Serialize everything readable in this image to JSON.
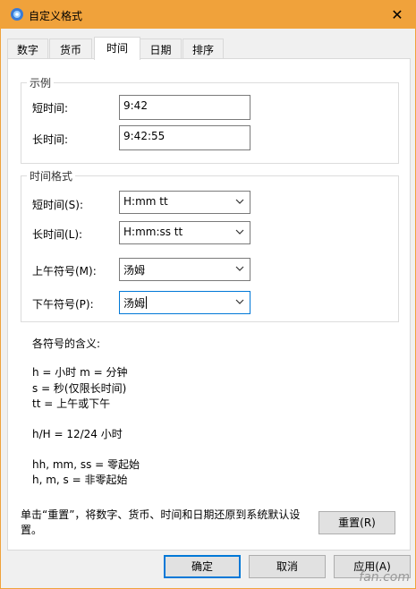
{
  "window": {
    "title": "自定义格式",
    "close_glyph": "✕"
  },
  "tabs": [
    {
      "label": "数字"
    },
    {
      "label": "货币"
    },
    {
      "label": "时间",
      "active": true
    },
    {
      "label": "日期"
    },
    {
      "label": "排序"
    }
  ],
  "sample": {
    "group_label": "示例",
    "short_label": "短时间:",
    "short_value": "9:42",
    "long_label": "长时间:",
    "long_value": "9:42:55"
  },
  "formats": {
    "group_label": "时间格式",
    "short_label": "短时间(S):",
    "short_value": "H:mm tt",
    "long_label": "长时间(L):",
    "long_value": "H:mm:ss tt",
    "am_label": "上午符号(M):",
    "am_value": "汤姆",
    "pm_label": "下午符号(P):",
    "pm_value": "汤姆"
  },
  "legend": {
    "heading": "各符号的含义:",
    "line1": "h = 小时   m = 分钟",
    "line2": "s = 秒(仅限长时间)",
    "line3": "tt = 上午或下午",
    "line4": "h/H = 12/24 小时",
    "line5": "hh, mm, ss = 零起始",
    "line6": "h, m, s = 非零起始"
  },
  "reset": {
    "note": "单击“重置”，将数字、货币、时间和日期还原到系统默认设置。",
    "button": "重置(R)"
  },
  "footer": {
    "ok": "确定",
    "cancel": "取消",
    "apply": "应用(A)"
  },
  "watermark": "fan.com",
  "colors": {
    "titlebar": "#f0a23b",
    "focus": "#0078d7"
  }
}
